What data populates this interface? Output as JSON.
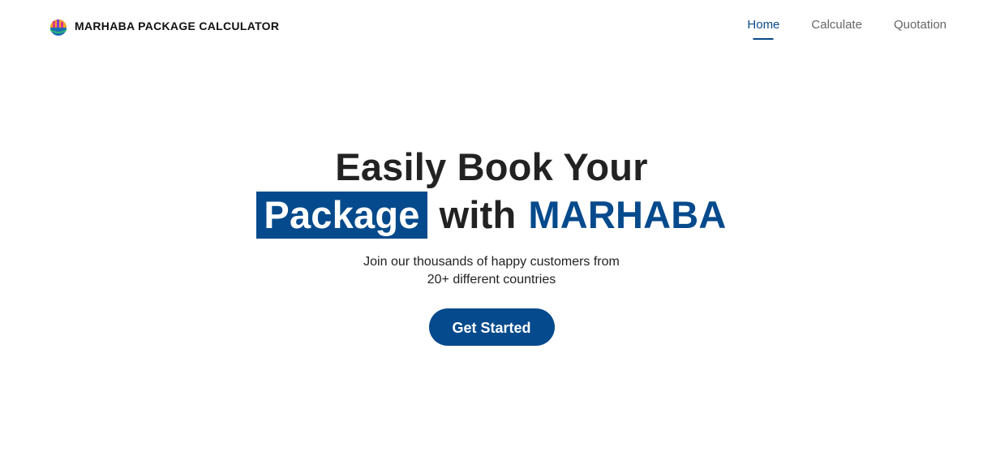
{
  "header": {
    "brand_name": "MARHABA PACKAGE CALCULATOR",
    "logo_icon": "marhaba-logo-icon",
    "nav": [
      {
        "label": "Home",
        "active": true
      },
      {
        "label": "Calculate",
        "active": false
      },
      {
        "label": "Quotation",
        "active": false
      }
    ]
  },
  "hero": {
    "title_line1": "Easily Book Your",
    "highlight_word": "Package",
    "with_word": "with",
    "brand_word": "MARHABA",
    "subtitle_line1": "Join our thousands of happy customers from",
    "subtitle_line2": "20+ different countries",
    "cta_label": "Get Started"
  },
  "colors": {
    "primary": "#044a8c",
    "text_dark": "#222222",
    "nav_inactive": "#666666",
    "background": "#ffffff"
  }
}
